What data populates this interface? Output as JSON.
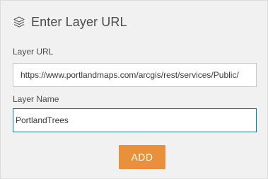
{
  "header": {
    "icon": "layers-icon",
    "title": "Enter Layer URL"
  },
  "form": {
    "layer_url": {
      "label": "Layer URL",
      "value": "https://www.portlandmaps.com/arcgis/rest/services/Public/"
    },
    "layer_name": {
      "label": "Layer Name",
      "value": "PortlandTrees"
    },
    "add_label": "ADD"
  },
  "colors": {
    "panel_bg": "#f1f1f1",
    "accent": "#e8913a",
    "focus_border": "#2b6ca3",
    "text": "#4c4c4c"
  }
}
